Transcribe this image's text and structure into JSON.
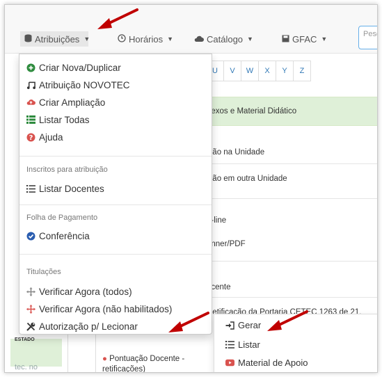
{
  "navbar": {
    "items": [
      {
        "label": "Atribuições",
        "icon": "database-icon"
      },
      {
        "label": "Horários",
        "icon": "clock-icon"
      },
      {
        "label": "Catálogo",
        "icon": "cloud-icon"
      },
      {
        "label": "GFAC",
        "icon": "save-icon"
      }
    ],
    "search_placeholder": "Pesq"
  },
  "background": {
    "letters": [
      "U",
      "V",
      "W",
      "X",
      "Y",
      "Z"
    ],
    "green_bar_text": "nexos e Material Didático",
    "rows": [
      "ição na Unidade",
      "ição em outra Unidade",
      "n-line",
      "anner/PDF",
      "ocente",
      "Retificação da Portaria CETEC 1263 de 21."
    ],
    "left_estado": "ESTADO",
    "left_text": "tec. no",
    "pontuacao_line1": "Pontuação Docente -",
    "pontuacao_line2": "retificações)"
  },
  "dropdown": {
    "section1": [
      {
        "label": "Criar Nova/Duplicar",
        "icon": "plus-circle-icon",
        "color": "#2e8b3e"
      },
      {
        "label": "Atribuição NOVOTEC",
        "icon": "music-icon",
        "color": "#333333"
      },
      {
        "label": "Criar Ampliação",
        "icon": "cloud-upload-icon",
        "color": "#d9534f"
      },
      {
        "label": "Listar Todas",
        "icon": "list-table-icon",
        "color": "#2e8b3e"
      },
      {
        "label": "Ajuda",
        "icon": "question-circle-icon",
        "color": "#d9534f"
      }
    ],
    "header2": "Inscritos para atribuição",
    "section2": [
      {
        "label": "Listar Docentes",
        "icon": "list-icon",
        "color": "#333333"
      }
    ],
    "header3": "Folha de Pagamento",
    "section3": [
      {
        "label": "Conferência",
        "icon": "check-circle-icon",
        "color": "#2a5db0"
      }
    ],
    "header4": "Titulações",
    "section4": [
      {
        "label": "Verificar Agora (todos)",
        "icon": "arrows-icon",
        "color": "#888888"
      },
      {
        "label": "Verificar Agora (não habilitados)",
        "icon": "arrows-icon",
        "color": "#d9534f"
      },
      {
        "label": "Autorização p/ Lecionar",
        "icon": "wrench-icon",
        "color": "#333333"
      }
    ]
  },
  "submenu": [
    {
      "label": "Gerar",
      "icon": "sign-in-icon"
    },
    {
      "label": "Listar",
      "icon": "list-icon"
    },
    {
      "label": "Material de Apoio",
      "icon": "youtube-icon"
    }
  ],
  "colors": {
    "accent": "#337ab7",
    "annotation_arrow": "#c00000",
    "green_bg": "#dff0d8"
  }
}
